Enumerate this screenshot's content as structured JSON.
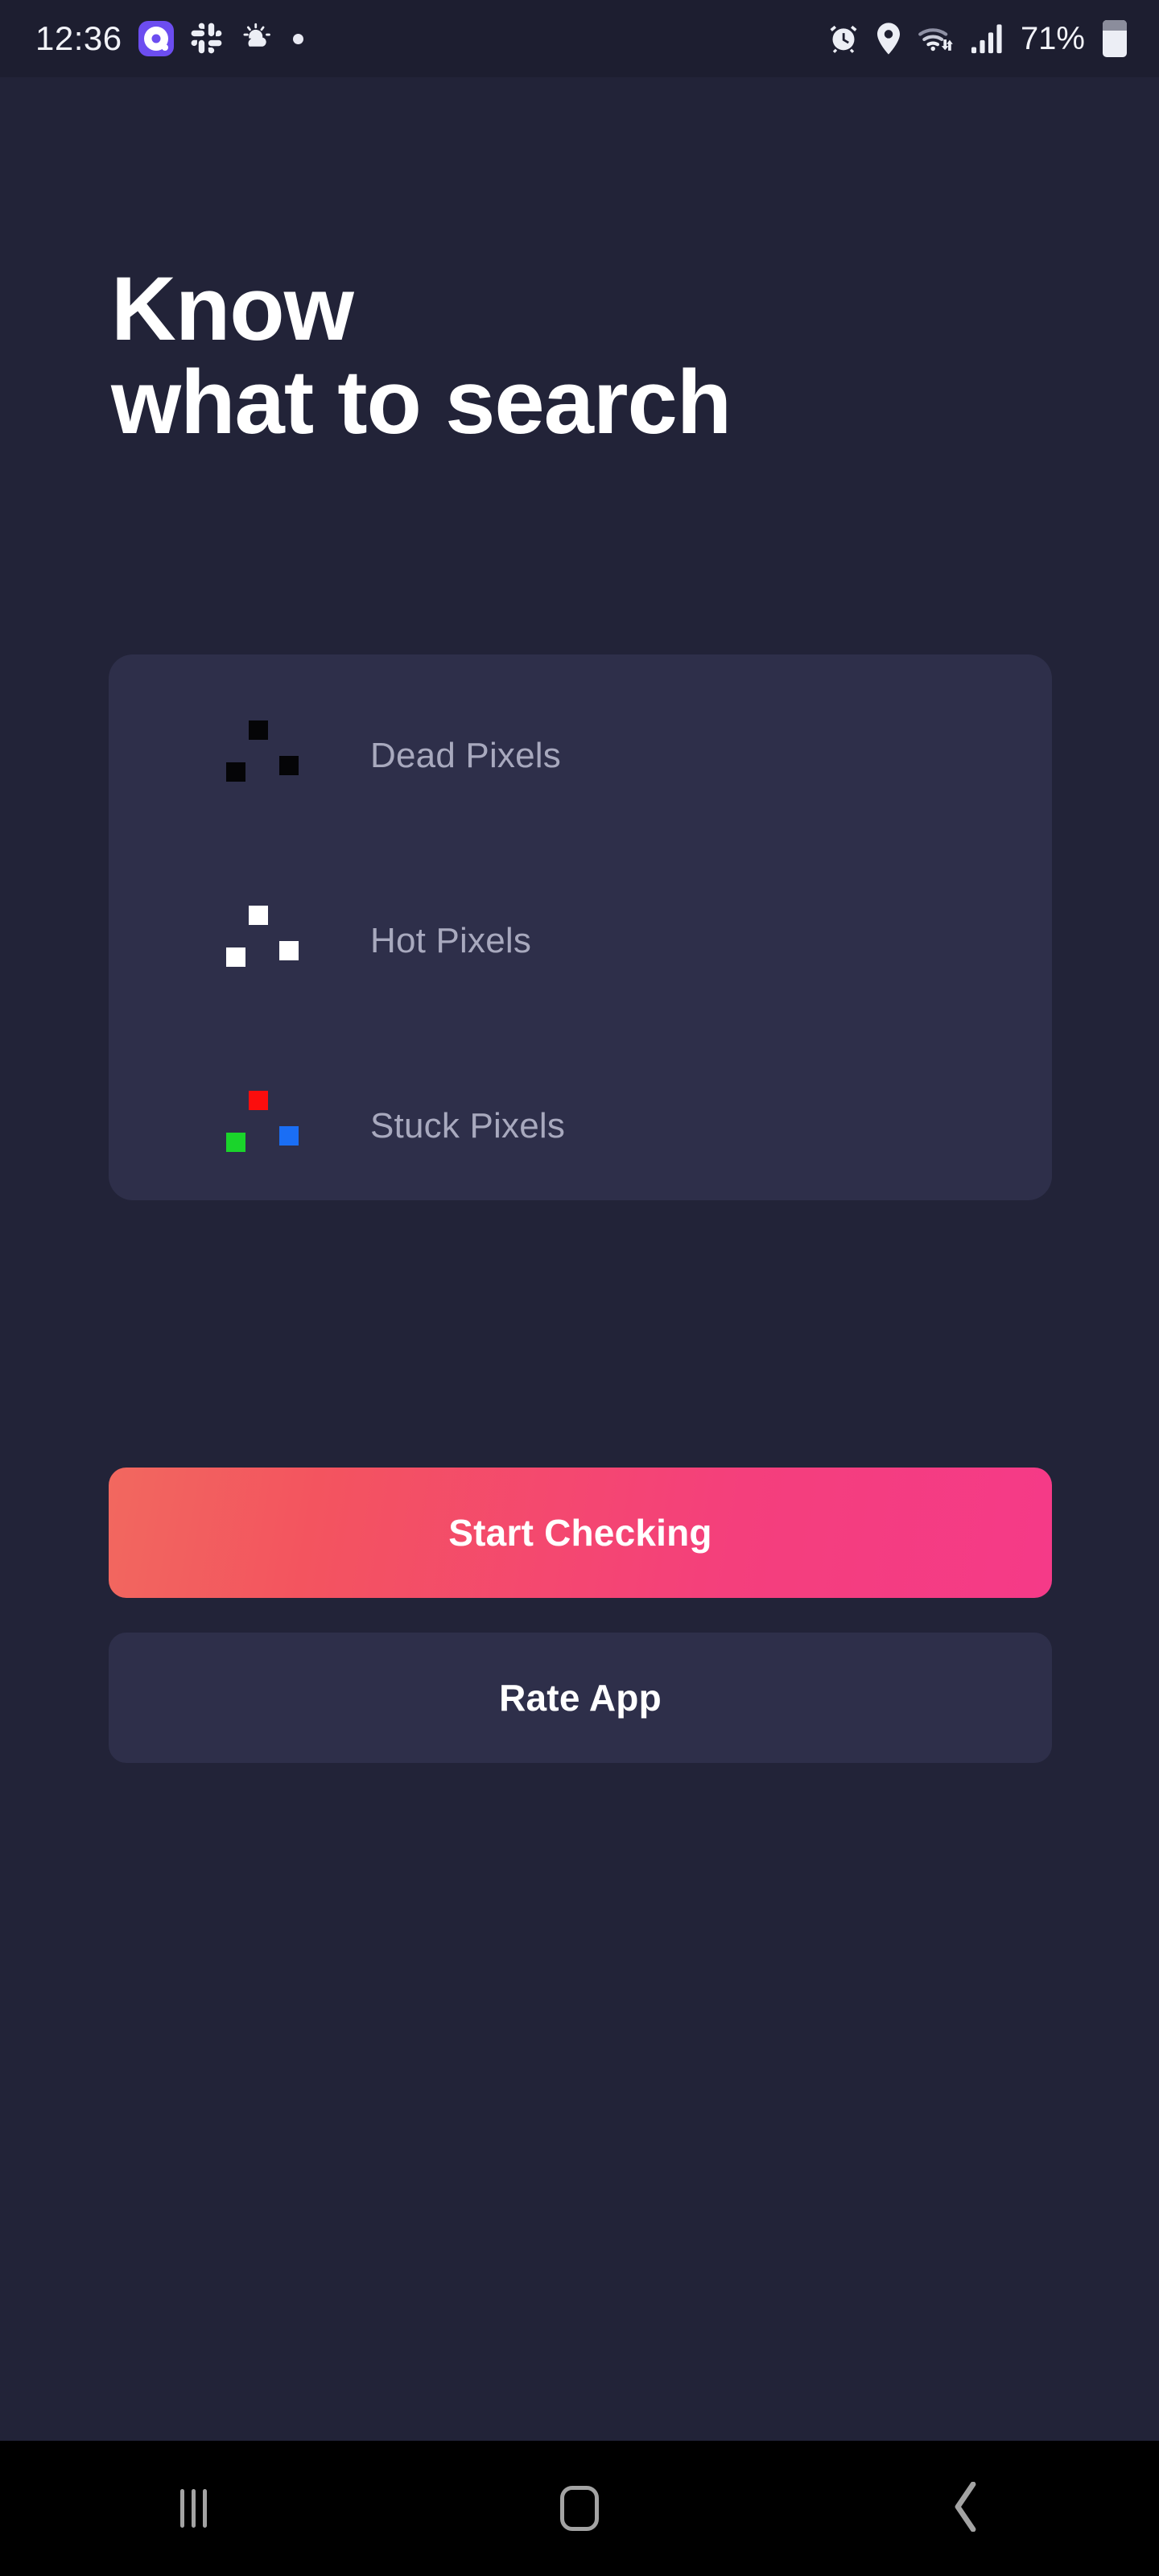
{
  "status_bar": {
    "time": "12:36",
    "icons_left": [
      "app-badge-icon",
      "slack-icon",
      "weather-partly-cloudy-icon",
      "dot-icon"
    ],
    "icons_right": [
      "alarm-icon",
      "location-pin-icon",
      "wifi-icon",
      "signal-bars-icon"
    ],
    "battery_percent": "71%",
    "battery_icon": "battery-icon",
    "colors": {
      "background": "#1d1e30",
      "text": "#f2f3f8",
      "app_badge": "#6c4df0"
    }
  },
  "screen": {
    "background": "#222338",
    "headline": "Know\nwhat to search"
  },
  "info_card": {
    "background": "#2e2f4a",
    "rows": [
      {
        "label": "Dead Pixels",
        "icon": "dead-pixels-icon",
        "swatches": {
          "top": "#050507",
          "bottom_left": "#050507",
          "bottom_right": "#050507"
        }
      },
      {
        "label": "Hot Pixels",
        "icon": "hot-pixels-icon",
        "swatches": {
          "top": "#ffffff",
          "bottom_left": "#ffffff",
          "bottom_right": "#ffffff"
        }
      },
      {
        "label": "Stuck Pixels",
        "icon": "stuck-pixels-icon",
        "swatches": {
          "top": "#fc0d0d",
          "bottom_left": "#1ad42b",
          "bottom_right": "#1a6ef5"
        }
      }
    ]
  },
  "actions": {
    "primary": {
      "label": "Start Checking",
      "gradient_from": "#f2685f",
      "gradient_to": "#f53a88"
    },
    "secondary": {
      "label": "Rate App",
      "background": "#2e2f4a"
    }
  },
  "nav_bar": {
    "background": "#000000",
    "tint": "#a3a3a3",
    "buttons": [
      "recents-icon",
      "home-icon",
      "back-icon"
    ]
  }
}
